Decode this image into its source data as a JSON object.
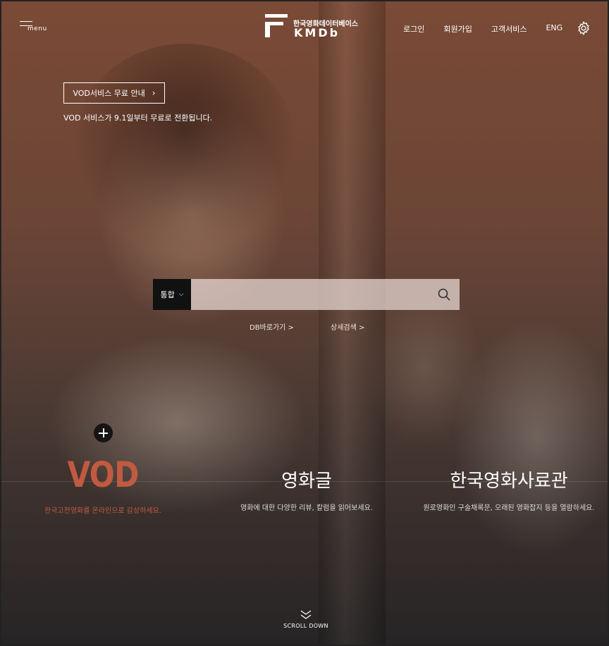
{
  "header": {
    "menu_label": "menu",
    "logo": {
      "subtitle": "한국영화데이터베이스",
      "title": "KMDb"
    },
    "nav": [
      "로그인",
      "회원가입",
      "고객서비스",
      "ENG"
    ],
    "settings_icon": "gear-icon"
  },
  "notice": {
    "button_label": "VOD서비스 무료 안내",
    "button_icon": "chevron-right-icon",
    "text": "VOD 서비스가 9.1일부터 무료로 전환됩니다."
  },
  "search": {
    "scope": "통합",
    "scope_icon": "chevron-down-icon",
    "value": "",
    "placeholder": "",
    "button_icon": "search-icon"
  },
  "quick_links": [
    "DB바로가기 >",
    "상세검색 >"
  ],
  "features": [
    {
      "title": "VOD",
      "description": "한국고전영화를 온라인으로 감상하세요."
    },
    {
      "title": "영화글",
      "description": "영화에 대한 다양한 리뷰, 칼럼을 읽어보세요."
    },
    {
      "title": "한국영화사료관",
      "description": "원로영화인 구술채록문, 오래된 영화잡지 등을 열람하세요."
    }
  ],
  "scroll": {
    "label": "SCROLL DOWN",
    "icon": "double-chevron-down-icon"
  },
  "colors": {
    "accent": "#c05a40",
    "search_scope_bg": "#111111"
  }
}
